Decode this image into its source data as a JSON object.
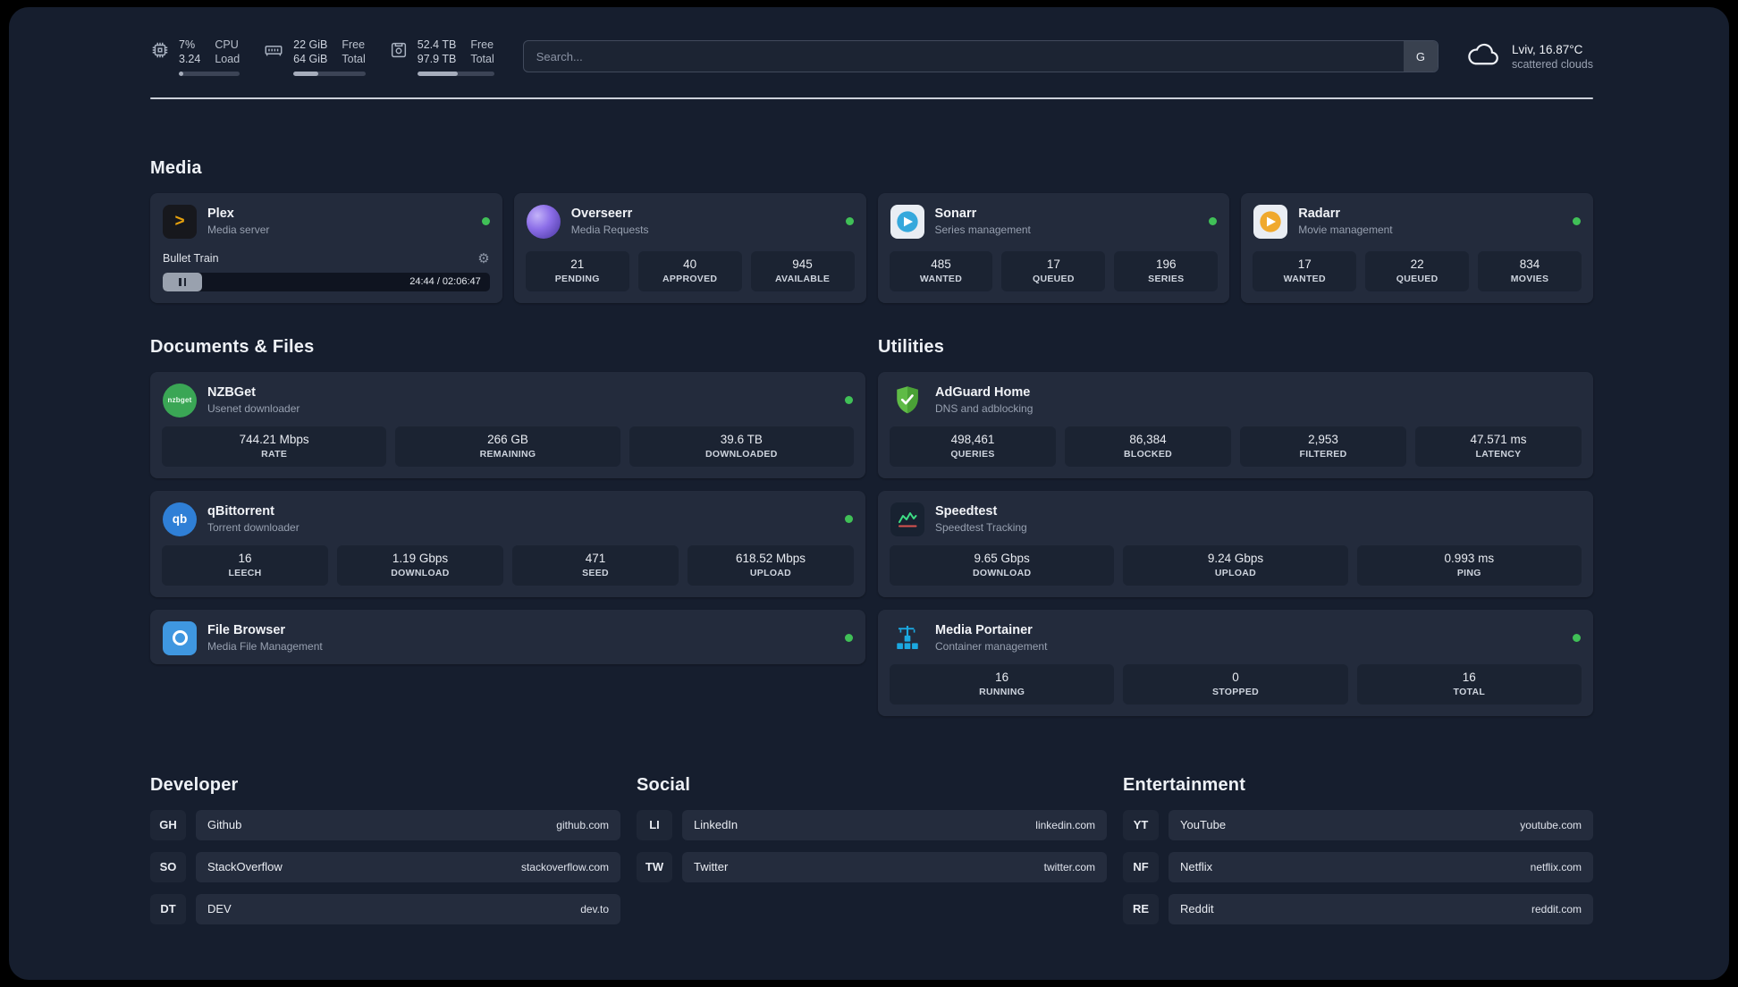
{
  "colors": {
    "panel_background": "#161e2e",
    "card_background": "#232b3c",
    "stat_tile_background": "#1b2332",
    "status_online": "#40c057",
    "plex_accent": "#e5a00d",
    "divider": "#dbe0e8"
  },
  "topbar": {
    "cpu": {
      "value_top": "7%",
      "value_bottom": "3.24",
      "label_top": "CPU",
      "label_bottom": "Load",
      "progress_percent": 7
    },
    "memory": {
      "value_top": "22 GiB",
      "value_bottom": "64 GiB",
      "label_top": "Free",
      "label_bottom": "Total",
      "progress_percent": 34
    },
    "storage": {
      "value_top": "52.4 TB",
      "value_bottom": "97.9 TB",
      "label_top": "Free",
      "label_bottom": "Total",
      "progress_percent": 53
    },
    "search": {
      "placeholder": "Search...",
      "button_label": "G"
    },
    "weather": {
      "location": "Lviv, 16.87°C",
      "condition": "scattered clouds"
    }
  },
  "media": {
    "title": "Media",
    "plex": {
      "name": "Plex",
      "subtitle": "Media server",
      "now_playing": "Bullet Train",
      "time_display": "24:44 / 02:06:47"
    },
    "overseerr": {
      "name": "Overseerr",
      "subtitle": "Media Requests",
      "stats": [
        {
          "value": "21",
          "label": "PENDING"
        },
        {
          "value": "40",
          "label": "APPROVED"
        },
        {
          "value": "945",
          "label": "AVAILABLE"
        }
      ]
    },
    "sonarr": {
      "name": "Sonarr",
      "subtitle": "Series management",
      "stats": [
        {
          "value": "485",
          "label": "WANTED"
        },
        {
          "value": "17",
          "label": "QUEUED"
        },
        {
          "value": "196",
          "label": "SERIES"
        }
      ]
    },
    "radarr": {
      "name": "Radarr",
      "subtitle": "Movie management",
      "stats": [
        {
          "value": "17",
          "label": "WANTED"
        },
        {
          "value": "22",
          "label": "QUEUED"
        },
        {
          "value": "834",
          "label": "MOVIES"
        }
      ]
    }
  },
  "documents": {
    "title": "Documents & Files",
    "nzbget": {
      "name": "NZBGet",
      "subtitle": "Usenet downloader",
      "icon_text": "nzbget",
      "stats": [
        {
          "value": "744.21 Mbps",
          "label": "RATE"
        },
        {
          "value": "266 GB",
          "label": "REMAINING"
        },
        {
          "value": "39.6 TB",
          "label": "DOWNLOADED"
        }
      ]
    },
    "qbittorrent": {
      "name": "qBittorrent",
      "subtitle": "Torrent downloader",
      "icon_text": "qb",
      "stats": [
        {
          "value": "16",
          "label": "LEECH"
        },
        {
          "value": "1.19 Gbps",
          "label": "DOWNLOAD"
        },
        {
          "value": "471",
          "label": "SEED"
        },
        {
          "value": "618.52 Mbps",
          "label": "UPLOAD"
        }
      ]
    },
    "filebrowser": {
      "name": "File Browser",
      "subtitle": "Media File Management"
    }
  },
  "utilities": {
    "title": "Utilities",
    "adguard": {
      "name": "AdGuard Home",
      "subtitle": "DNS and adblocking",
      "stats": [
        {
          "value": "498,461",
          "label": "QUERIES"
        },
        {
          "value": "86,384",
          "label": "BLOCKED"
        },
        {
          "value": "2,953",
          "label": "FILTERED"
        },
        {
          "value": "47.571 ms",
          "label": "LATENCY"
        }
      ]
    },
    "speedtest": {
      "name": "Speedtest",
      "subtitle": "Speedtest Tracking",
      "stats": [
        {
          "value": "9.65 Gbps",
          "label": "DOWNLOAD"
        },
        {
          "value": "9.24 Gbps",
          "label": "UPLOAD"
        },
        {
          "value": "0.993 ms",
          "label": "PING"
        }
      ]
    },
    "portainer": {
      "name": "Media Portainer",
      "subtitle": "Container management",
      "stats": [
        {
          "value": "16",
          "label": "RUNNING"
        },
        {
          "value": "0",
          "label": "STOPPED"
        },
        {
          "value": "16",
          "label": "TOTAL"
        }
      ]
    }
  },
  "bookmarks": {
    "developer": {
      "title": "Developer",
      "items": [
        {
          "abbr": "GH",
          "name": "Github",
          "url": "github.com"
        },
        {
          "abbr": "SO",
          "name": "StackOverflow",
          "url": "stackoverflow.com"
        },
        {
          "abbr": "DT",
          "name": "DEV",
          "url": "dev.to"
        }
      ]
    },
    "social": {
      "title": "Social",
      "items": [
        {
          "abbr": "LI",
          "name": "LinkedIn",
          "url": "linkedin.com"
        },
        {
          "abbr": "TW",
          "name": "Twitter",
          "url": "twitter.com"
        }
      ]
    },
    "entertainment": {
      "title": "Entertainment",
      "items": [
        {
          "abbr": "YT",
          "name": "YouTube",
          "url": "youtube.com"
        },
        {
          "abbr": "NF",
          "name": "Netflix",
          "url": "netflix.com"
        },
        {
          "abbr": "RE",
          "name": "Reddit",
          "url": "reddit.com"
        }
      ]
    }
  }
}
